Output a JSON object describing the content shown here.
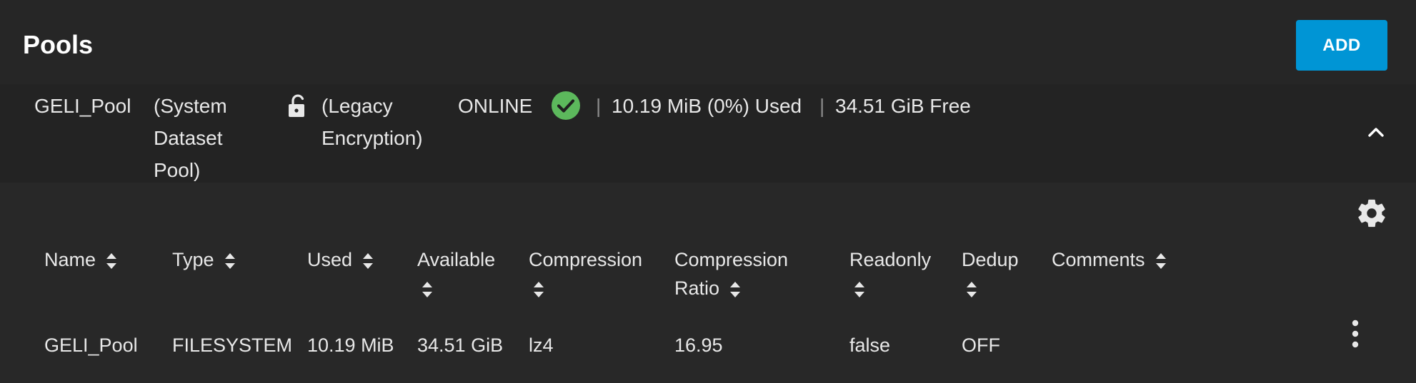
{
  "page": {
    "title": "Pools",
    "add_label": "ADD"
  },
  "pool": {
    "name": "GELI_Pool",
    "system_dataset": "(System\nDataset\nPool)",
    "encryption": "(Legacy\nEncryption)",
    "status": "ONLINE",
    "separator": "|",
    "used": "10.19 MiB (0%) Used",
    "free": "34.51 GiB Free",
    "status_color": "#5cb85c"
  },
  "icons": {
    "lock": "lock-open-icon",
    "status": "check-circle-icon",
    "collapse": "chevron-up-icon",
    "settings": "gear-icon",
    "sort": "sort-icon",
    "row_menu": "more-vert-icon"
  },
  "table": {
    "columns": [
      "Name",
      "Type",
      "Used",
      "Available",
      "Compression",
      "Compression",
      "Ratio",
      "Readonly",
      "Dedup",
      "Comments"
    ],
    "rows": [
      [
        "GELI_Pool",
        "FILESYSTEM",
        "10.19 MiB",
        "34.51 GiB",
        "lz4",
        "16.95",
        "false",
        "OFF",
        ""
      ]
    ]
  }
}
